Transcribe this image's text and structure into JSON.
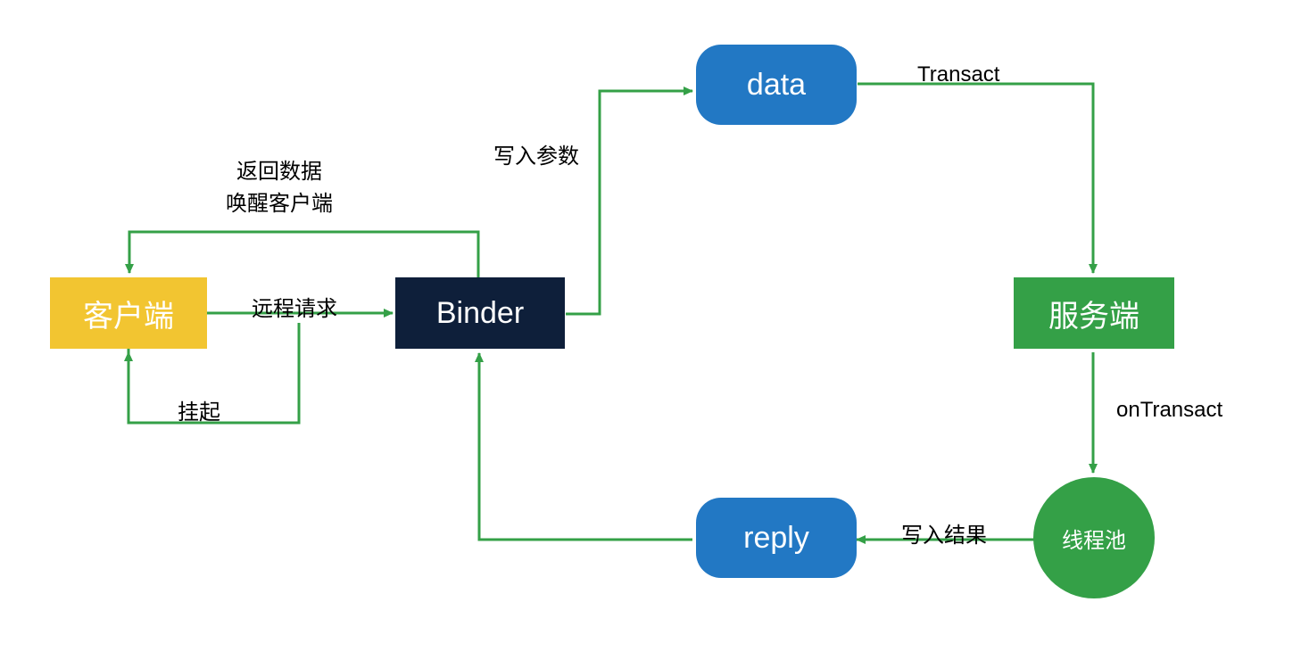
{
  "nodes": {
    "client": {
      "text": "客户端",
      "bg": "#F2C531",
      "fontSize": 34
    },
    "binder": {
      "text": "Binder",
      "bg": "#0E1F3A",
      "fontSize": 34
    },
    "data": {
      "text": "data",
      "bg": "#2278C4",
      "fontSize": 34
    },
    "server": {
      "text": "服务端",
      "bg": "#34A047",
      "fontSize": 34
    },
    "threadpool": {
      "text": "线程池",
      "bg": "#34A047",
      "fontSize": 22
    },
    "reply": {
      "text": "reply",
      "bg": "#2278C4",
      "fontSize": 34
    }
  },
  "labels": {
    "remoteReq": "远程请求",
    "suspend": "挂起",
    "returnData": "返回数据",
    "wakeClient": "唤醒客户端",
    "writeArgs": "写入参数",
    "transact": "Transact",
    "onTransact": "onTransact",
    "writeResult": "写入结果"
  },
  "colors": {
    "arrow": "#34A047"
  }
}
